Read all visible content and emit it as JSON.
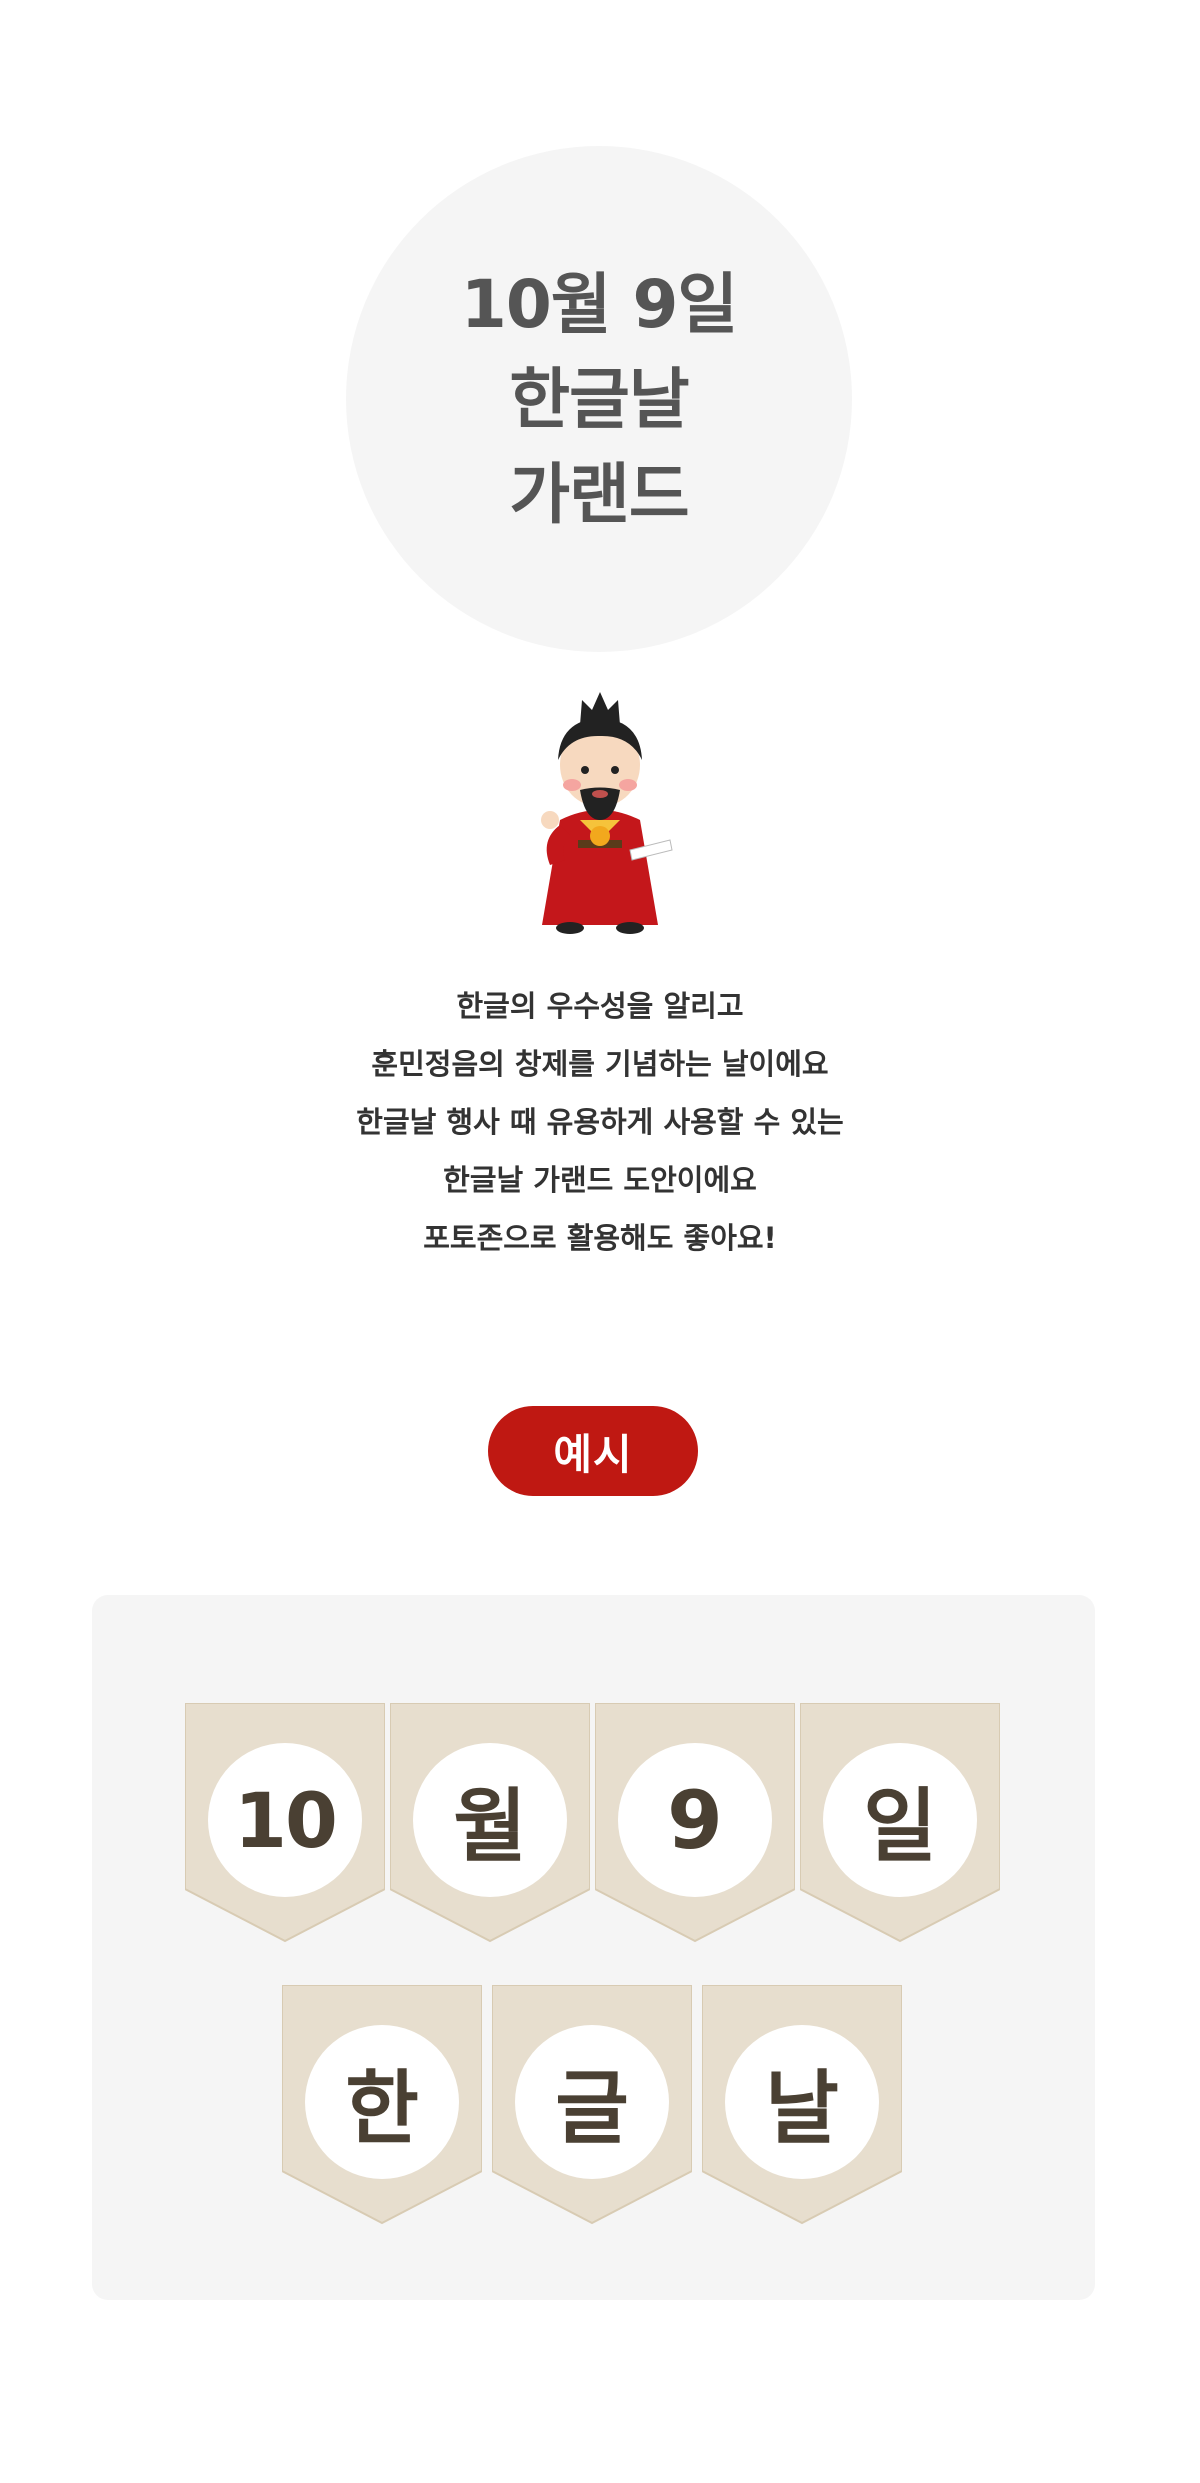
{
  "hero": {
    "line1": "10월 9일",
    "line2": "한글날",
    "line3": "가랜드"
  },
  "description": {
    "lines": [
      "한글의 우수성을 알리고",
      "훈민정음의 창제를 기념하는 날이에요",
      "한글날 행사 때 유용하게 사용할 수 있는",
      "한글날 가랜드 도안이에요",
      "포토존으로 활용해도 좋아요!"
    ]
  },
  "example_label": "예시",
  "garland": {
    "row1": [
      "10",
      "월",
      "9",
      "일"
    ],
    "row2": [
      "한",
      "글",
      "날"
    ]
  },
  "colors": {
    "accent": "#bf1812",
    "flag_bg": "#e7dece",
    "flag_text": "#4a4033",
    "panel_bg": "#f5f5f5"
  }
}
